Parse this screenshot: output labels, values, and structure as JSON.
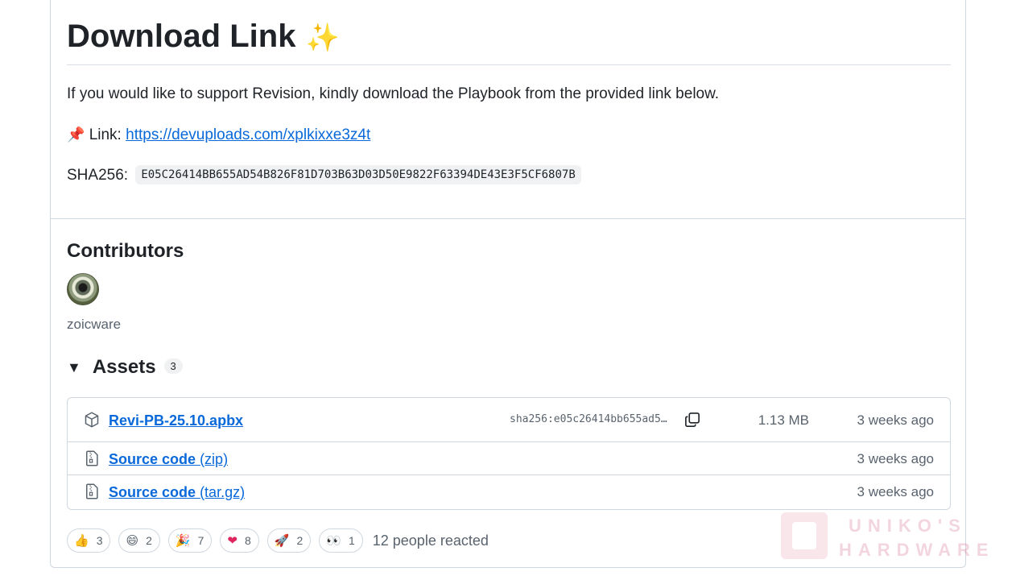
{
  "release": {
    "heading": "Download Link",
    "heading_emoji": "✨",
    "support_text": "If you would like to support Revision, kindly download the Playbook from the provided link below.",
    "link_emoji": "📌",
    "link_label": "Link:",
    "link_url": "https://devuploads.com/xplkixxe3z4t",
    "sha_label": "SHA256:",
    "sha_value": "E05C26414BB655AD54B826F81D703B63D03D50E9822F63394DE43E3F5CF6807B"
  },
  "contributors": {
    "title": "Contributors",
    "users": [
      {
        "name": "zoicware"
      }
    ]
  },
  "assets": {
    "title": "Assets",
    "count": "3",
    "toggle_icon": "triangle-down-icon",
    "items": [
      {
        "name": "Revi-PB-25.10.apbx",
        "sha": "sha256:e05c26414bb655ad5…",
        "size": "1.13 MB",
        "time": "3 weeks ago",
        "icon": "package-icon"
      },
      {
        "name": "Source code",
        "ext": "(zip)",
        "time": "3 weeks ago",
        "icon": "file-zip-icon"
      },
      {
        "name": "Source code",
        "ext": "(tar.gz)",
        "time": "3 weeks ago",
        "icon": "file-zip-icon"
      }
    ]
  },
  "reactions": {
    "items": [
      {
        "emoji": "👍",
        "count": "3",
        "name": "thumbs-up"
      },
      {
        "emoji": "😄",
        "count": "2",
        "name": "laugh"
      },
      {
        "emoji": "🎉",
        "count": "7",
        "name": "hooray"
      },
      {
        "emoji": "❤",
        "count": "8",
        "name": "heart"
      },
      {
        "emoji": "🚀",
        "count": "2",
        "name": "rocket"
      },
      {
        "emoji": "👀",
        "count": "1",
        "name": "eyes"
      }
    ],
    "summary": "12 people reacted"
  },
  "watermark": {
    "line1": "UNIKO'S",
    "line2": "HARDWARE"
  },
  "colors": {
    "link": "#0969da",
    "border": "#d0d7de",
    "muted": "#59636e",
    "text": "#1f2328"
  }
}
